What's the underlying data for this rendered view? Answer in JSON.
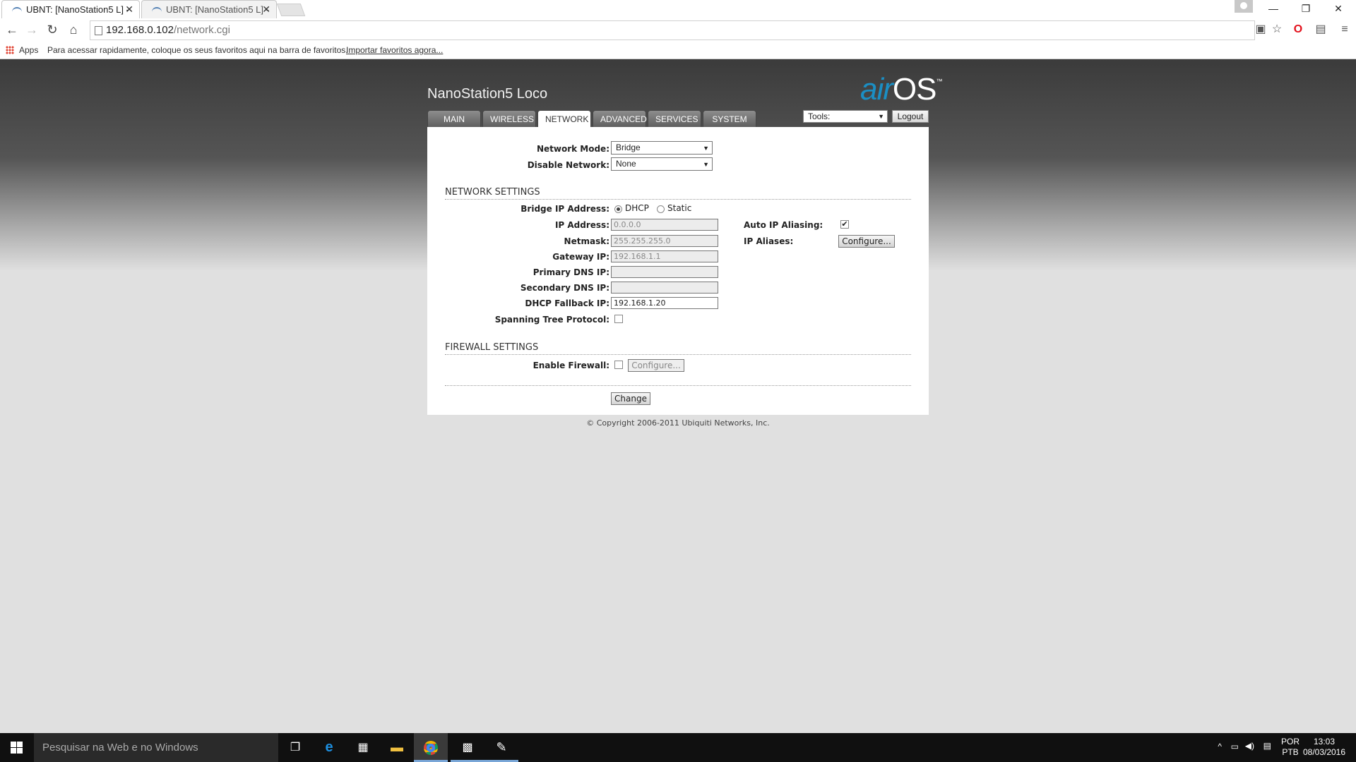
{
  "browser": {
    "tabs": [
      {
        "title": "UBNT: [NanoStation5 L] - "
      },
      {
        "title": "UBNT: [NanoStation5 L] - "
      }
    ],
    "url_host": "192.168.0.102",
    "url_path": "/network.cgi",
    "bookmarks": {
      "apps_label": "Apps",
      "hint": "Para acessar rapidamente, coloque os seus favoritos aqui na barra de favoritos.",
      "import_link": "Importar favoritos agora..."
    }
  },
  "device": {
    "name": "NanoStation5 Loco",
    "logo_air": "air",
    "logo_os": "OS",
    "logo_tm": "™"
  },
  "nav": {
    "tabs": [
      "MAIN",
      "WIRELESS",
      "NETWORK",
      "ADVANCED",
      "SERVICES",
      "SYSTEM"
    ],
    "active": "NETWORK",
    "tools_label": "Tools:",
    "logout_label": "Logout"
  },
  "form": {
    "network_mode_label": "Network Mode:",
    "network_mode_value": "Bridge",
    "disable_network_label": "Disable Network:",
    "disable_network_value": "None",
    "network_settings_title": "NETWORK SETTINGS",
    "bridge_ip_label": "Bridge IP Address:",
    "dhcp_label": "DHCP",
    "static_label": "Static",
    "ip_address_label": "IP Address:",
    "ip_address_value": "0.0.0.0",
    "netmask_label": "Netmask:",
    "netmask_value": "255.255.255.0",
    "gateway_label": "Gateway IP:",
    "gateway_value": "192.168.1.1",
    "primary_dns_label": "Primary DNS IP:",
    "primary_dns_value": "",
    "secondary_dns_label": "Secondary DNS IP:",
    "secondary_dns_value": "",
    "dhcp_fallback_label": "DHCP Fallback IP:",
    "dhcp_fallback_value": "192.168.1.20",
    "stp_label": "Spanning Tree Protocol:",
    "auto_ip_aliasing_label": "Auto IP Aliasing:",
    "ip_aliases_label": "IP Aliases:",
    "configure_label": "Configure...",
    "firewall_settings_title": "FIREWALL SETTINGS",
    "enable_firewall_label": "Enable Firewall:",
    "firewall_configure_label": "Configure...",
    "change_label": "Change",
    "checkmark": "✔"
  },
  "copyright": "© Copyright 2006-2011 Ubiquiti Networks, Inc.",
  "taskbar": {
    "search_placeholder": "Pesquisar na Web e no Windows",
    "lang_top": "POR",
    "lang_bottom": "PTB",
    "time": "13:03",
    "date": "08/03/2016"
  },
  "colors": {
    "accent": "#1b8fc4",
    "header_dark": "#3b3b3b"
  }
}
